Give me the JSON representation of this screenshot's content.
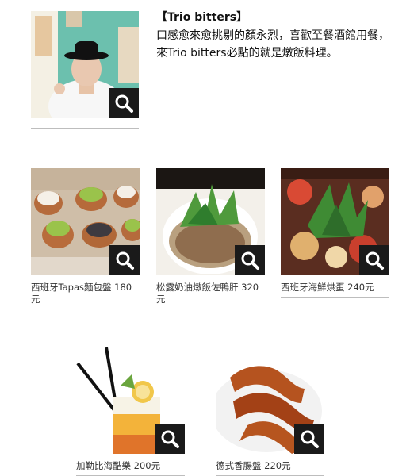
{
  "intro": {
    "title": "【Trio bitters】",
    "description": "口感愈來愈挑剔的顏永烈，喜歡至餐酒館用餐，來Trio bitters必點的就是燉飯料理。",
    "photo": "chef-portrait-photo",
    "zoom_icon": "magnifier-icon"
  },
  "dishes_row1": [
    {
      "caption": "西班牙Tapas麵包盤 180元",
      "photo": "tapas-bread-plate-photo"
    },
    {
      "caption": "松露奶油燉飯佐鴨肝 320元",
      "photo": "truffle-risotto-photo"
    },
    {
      "caption": "西班牙海鮮烘蛋 240元",
      "photo": "seafood-omelette-photo"
    }
  ],
  "dishes_row2": [
    {
      "caption": "加勒比海酷樂 200元",
      "photo": "caribbean-cooler-photo"
    },
    {
      "caption": "德式香腸盤 220元",
      "photo": "german-sausage-plate-photo"
    }
  ]
}
